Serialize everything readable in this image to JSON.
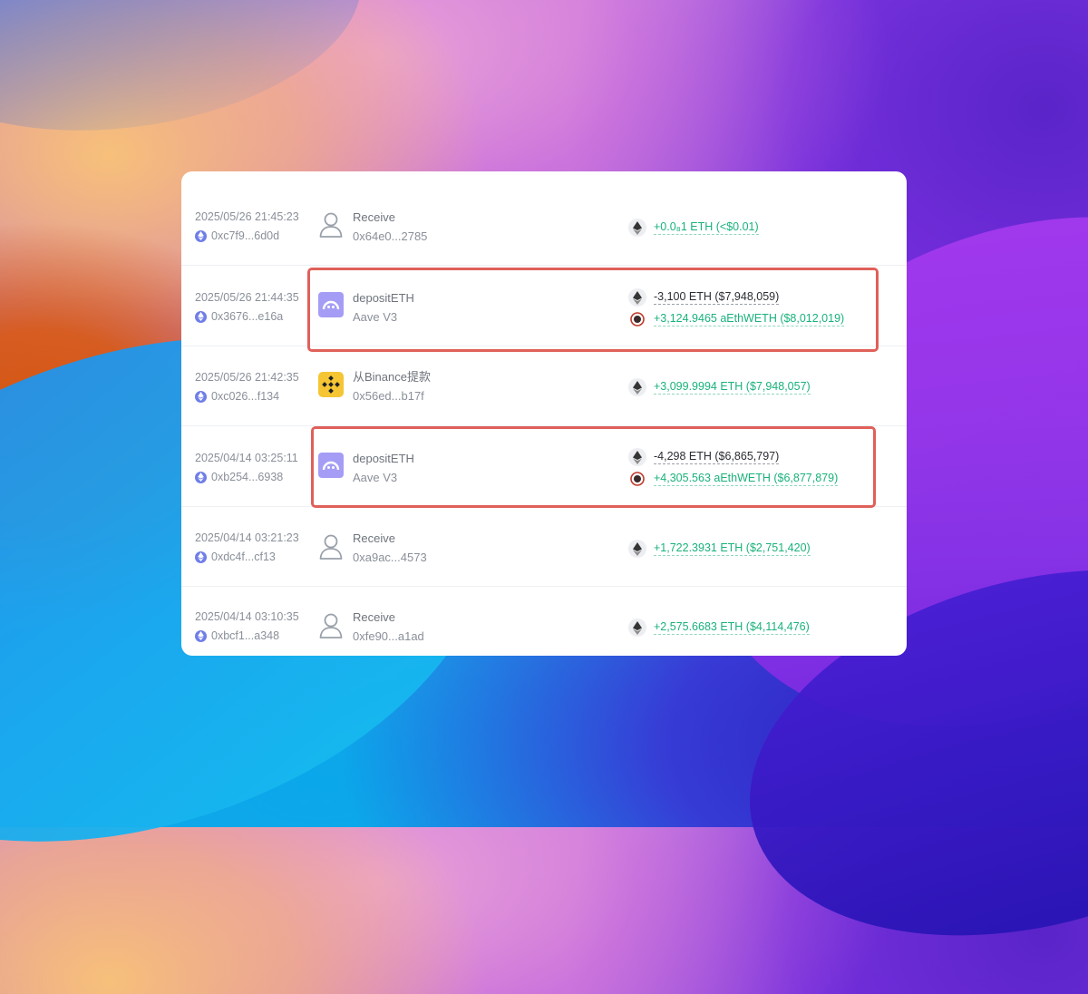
{
  "rows": [
    {
      "time": "2025/05/26 21:45:23",
      "tx_hash": "0xc7f9...6d0d",
      "icon": "user-icon",
      "name": "Receive",
      "address": "0x64e0...2785",
      "amounts": [
        {
          "token_icon": "eth-icon",
          "text": "+0.0₈1 ETH (<$0.01)",
          "sign": "positive"
        }
      ]
    },
    {
      "time": "2025/05/26 21:44:35",
      "tx_hash": "0x3676...e16a",
      "icon": "aave-logo-icon",
      "name": "depositETH",
      "address": "Aave V3",
      "amounts": [
        {
          "token_icon": "eth-icon",
          "text": "-3,100 ETH ($7,948,059)",
          "sign": "negative"
        },
        {
          "token_icon": "aethweth-icon",
          "text": "+3,124.9465 aEthWETH ($8,012,019)",
          "sign": "positive"
        }
      ]
    },
    {
      "time": "2025/05/26 21:42:35",
      "tx_hash": "0xc026...f134",
      "icon": "binance-logo-icon",
      "name": "从Binance提款",
      "address": "0x56ed...b17f",
      "amounts": [
        {
          "token_icon": "eth-icon",
          "text": "+3,099.9994 ETH ($7,948,057)",
          "sign": "positive"
        }
      ]
    },
    {
      "time": "2025/04/14 03:25:11",
      "tx_hash": "0xb254...6938",
      "icon": "aave-logo-icon",
      "name": "depositETH",
      "address": "Aave V3",
      "amounts": [
        {
          "token_icon": "eth-icon",
          "text": "-4,298 ETH ($6,865,797)",
          "sign": "negative"
        },
        {
          "token_icon": "aethweth-icon",
          "text": "+4,305.563 aEthWETH ($6,877,879)",
          "sign": "positive"
        }
      ]
    },
    {
      "time": "2025/04/14 03:21:23",
      "tx_hash": "0xdc4f...cf13",
      "icon": "user-icon",
      "name": "Receive",
      "address": "0xa9ac...4573",
      "amounts": [
        {
          "token_icon": "eth-icon",
          "text": "+1,722.3931 ETH ($2,751,420)",
          "sign": "positive"
        }
      ]
    },
    {
      "time": "2025/04/14 03:10:35",
      "tx_hash": "0xbcf1...a348",
      "icon": "user-icon",
      "name": "Receive",
      "address": "0xfe90...a1ad",
      "amounts": [
        {
          "token_icon": "eth-icon",
          "text": "+2,575.6683 ETH ($4,114,476)",
          "sign": "positive"
        }
      ]
    }
  ],
  "colors": {
    "positive": "#19b27a",
    "negative": "#2a2d33",
    "highlight_box": "#e0605a",
    "aave_logo": "#a59df5",
    "binance_logo": "#f5c533",
    "chain_dot": "#6f7ee8"
  }
}
